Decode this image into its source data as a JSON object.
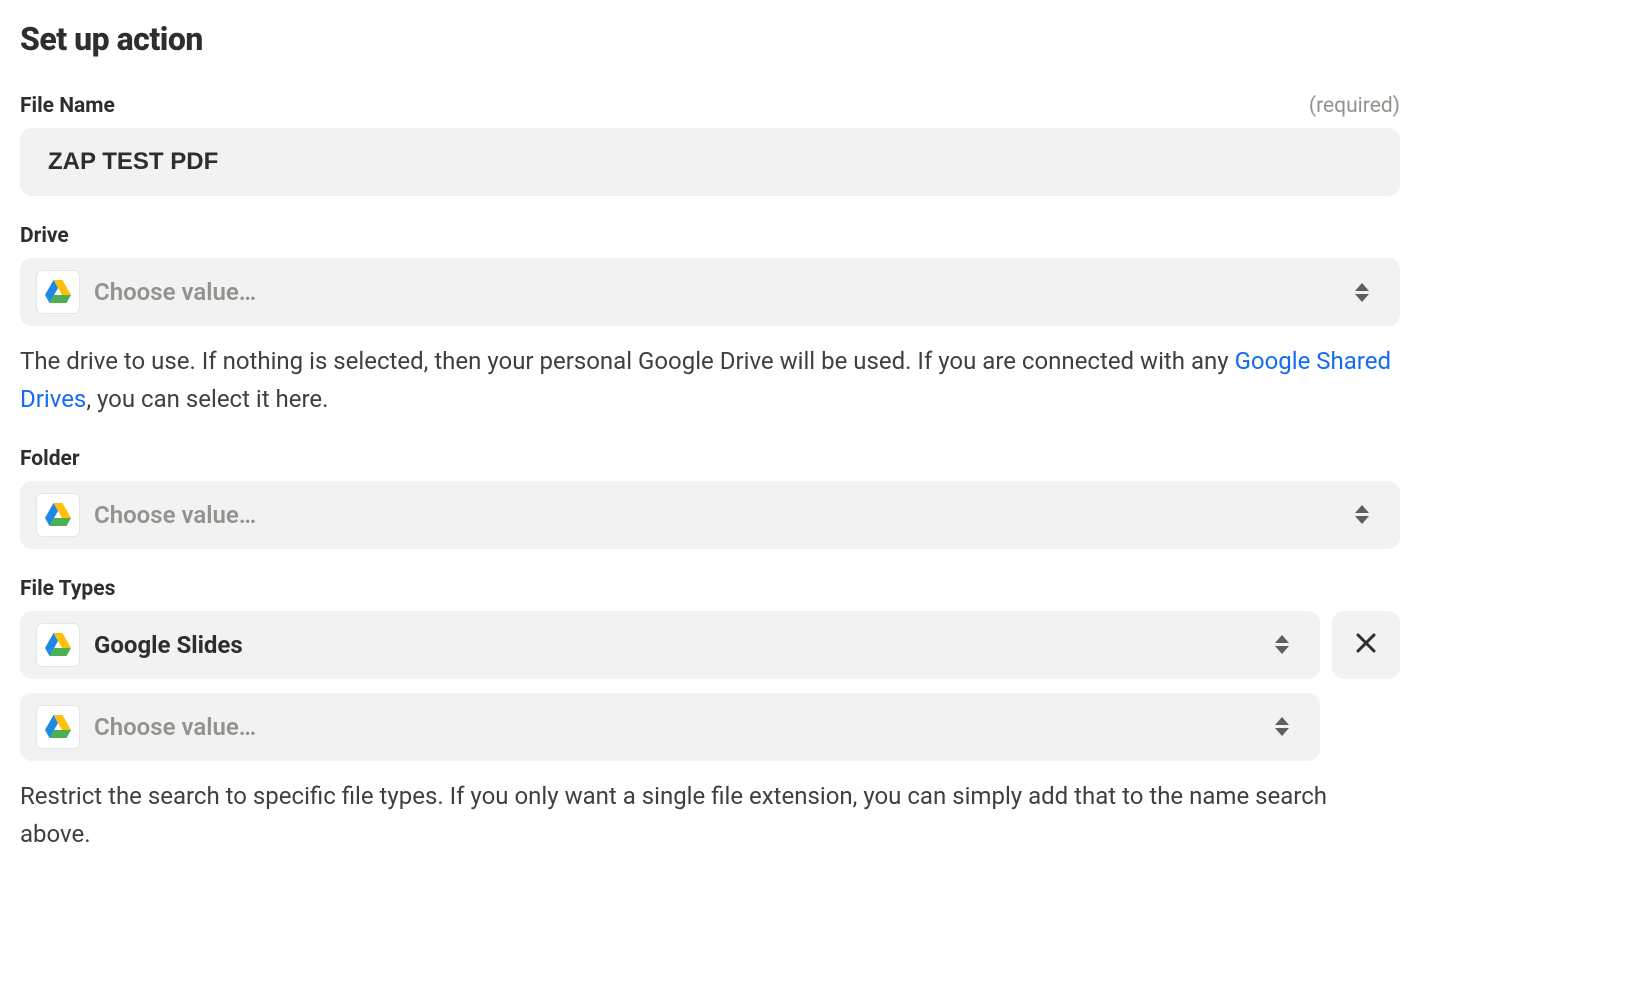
{
  "title": "Set up action",
  "fields": {
    "fileName": {
      "label": "File Name",
      "hint": "(required)",
      "value": "ZAP TEST PDF"
    },
    "drive": {
      "label": "Drive",
      "placeholder": "Choose value…",
      "helpBefore": "The drive to use. If nothing is selected, then your personal Google Drive will be used. If you are connected with any ",
      "helpLink": "Google Shared Drives",
      "helpAfter": ", you can select it here."
    },
    "folder": {
      "label": "Folder",
      "placeholder": "Choose value…"
    },
    "fileTypes": {
      "label": "File Types",
      "selected": "Google Slides",
      "placeholder": "Choose value…",
      "help": "Restrict the search to specific file types. If you only want a single file extension, you can simply add that to the name search above."
    }
  }
}
